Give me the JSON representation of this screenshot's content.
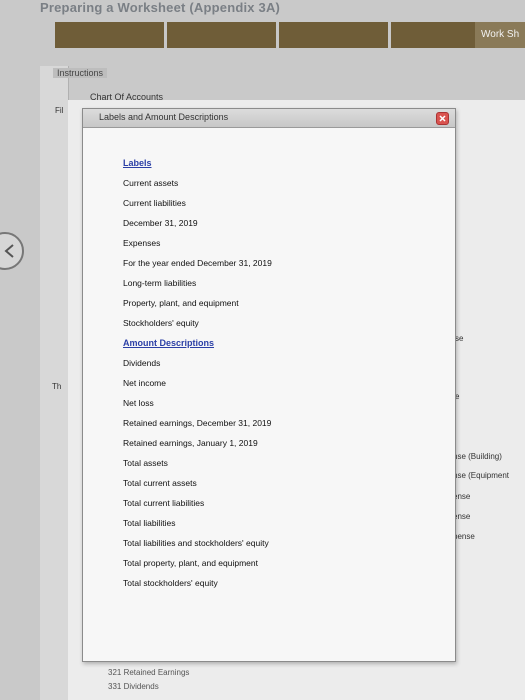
{
  "page": {
    "title": "Preparing a Worksheet (Appendix 3A)"
  },
  "topbar": {
    "worksheet_tab": "Work Sh"
  },
  "tabs": {
    "instructions": "Instructions",
    "chart_of_accounts": "Chart Of Accounts",
    "fi_fragment": "Fil",
    "th_fragment": "Th"
  },
  "dialog": {
    "title": "Labels and Amount Descriptions",
    "labels_heading": "Labels",
    "labels": [
      "Current assets",
      "Current liabilities",
      "December 31, 2019",
      "Expenses",
      "For the year ended December 31, 2019",
      "Long-term liabilities",
      "Property, plant, and equipment",
      "Stockholders' equity"
    ],
    "amount_heading": "Amount Descriptions",
    "amounts": [
      "Dividends",
      "Net income",
      "Net loss",
      "Retained earnings, December 31, 2019",
      "Retained earnings, January 1, 2019",
      "Total assets",
      "Total current assets",
      "Total current liabilities",
      "Total liabilities",
      "Total liabilities and stockholders' equity",
      "Total property, plant, and equipment",
      "Total stockholders' equity"
    ]
  },
  "background_fragments": {
    "f1": "se",
    "f2": "e",
    "f3": "nse (Building)",
    "f4": "nse (Equipment",
    "f5": "ense",
    "f6": "ense",
    "f7": "pense"
  },
  "bottom_rows": [
    "321  Retained Earnings",
    "331  Dividends"
  ],
  "colors": {
    "accent_link": "#2b3fa6",
    "topbar": "#6f5d38",
    "close": "#d9534f"
  }
}
